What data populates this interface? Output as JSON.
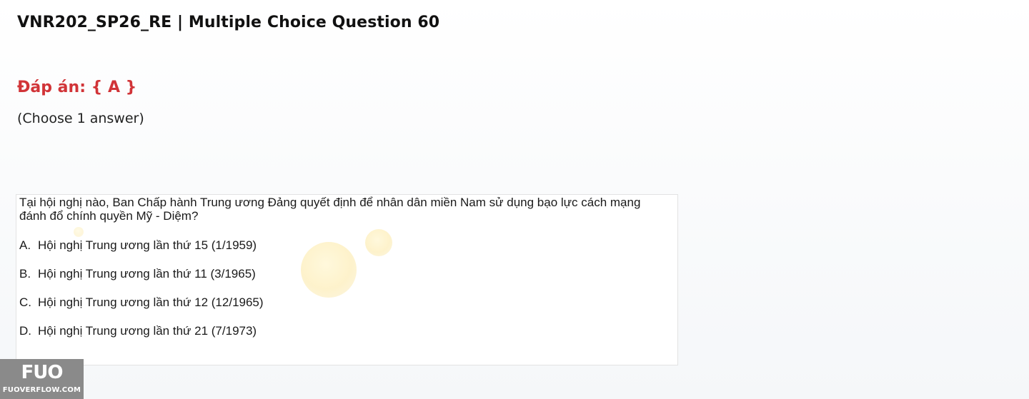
{
  "page": {
    "title": "VNR202_SP26_RE | Multiple Choice Question 60",
    "answer_heading": "Đáp án: { A }",
    "choose_hint": "(Choose 1 answer)"
  },
  "question": {
    "text": "Tại hội nghị nào, Ban Chấp hành Trung ương Đảng quyết định để nhân dân miền Nam  sử dụng bạo lực cách mạng đánh đổ chính quyền Mỹ - Diệm?",
    "options": [
      {
        "letter": "A.",
        "text": "Hội nghị Trung ương lần thứ 15 (1/1959)"
      },
      {
        "letter": "B.",
        "text": "Hội nghị Trung ương lần thứ 11 (3/1965)"
      },
      {
        "letter": "C.",
        "text": "Hội nghị Trung ương lần thứ 12 (12/1965)"
      },
      {
        "letter": "D.",
        "text": "Hội nghị Trung ương lần thứ 21 (7/1973)"
      }
    ]
  },
  "logo": {
    "mark": "FUO",
    "site": "FUOVERFLOW.COM"
  },
  "colors": {
    "answer_red": "#d13438",
    "logo_bg": "#8a8a8a"
  }
}
